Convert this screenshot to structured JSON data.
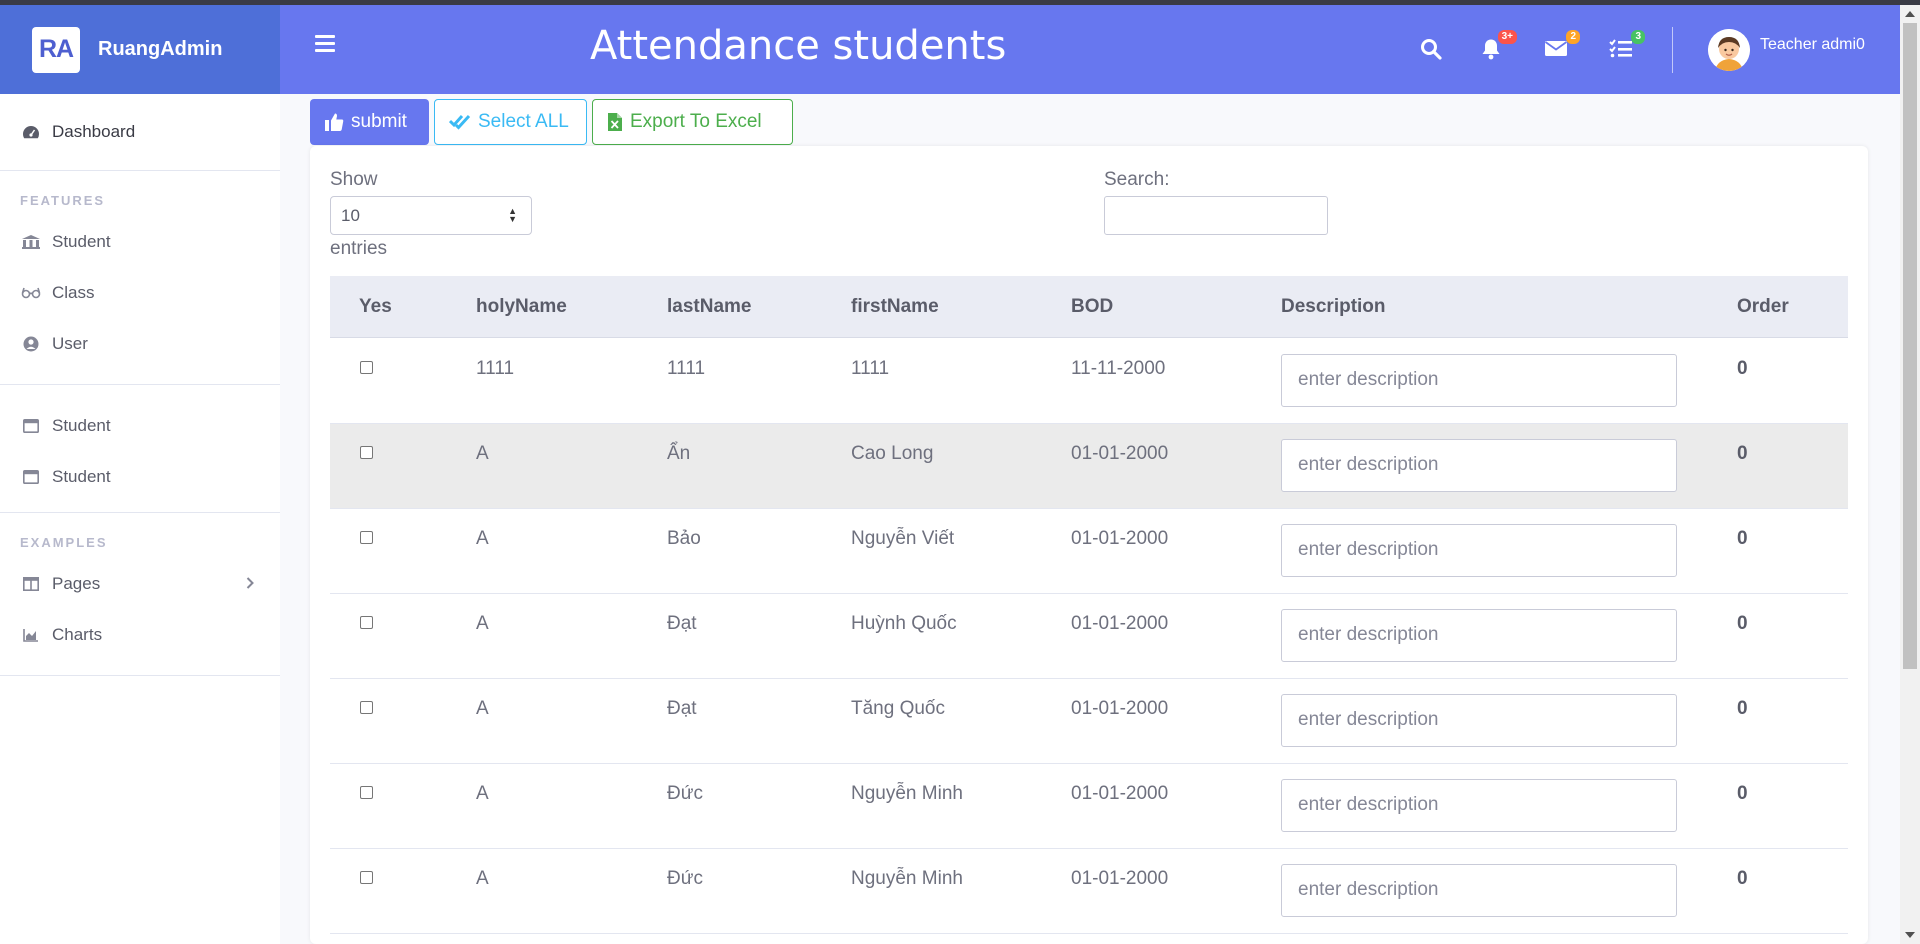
{
  "brand": {
    "logo_text": "RA",
    "name": "RuangAdmin"
  },
  "sidebar": {
    "dashboard": "Dashboard",
    "features_heading": "FEATURES",
    "features": [
      "Student",
      "Class",
      "User"
    ],
    "extra": [
      "Student",
      "Student"
    ],
    "examples_heading": "EXAMPLES",
    "examples": [
      "Pages",
      "Charts"
    ]
  },
  "topbar": {
    "title": "Attendance students",
    "notifications_badge": "3+",
    "messages_badge": "2",
    "tasks_badge": "3",
    "user_name": "Teacher admi0"
  },
  "actions": {
    "submit": "submit",
    "select_all": "Select ALL",
    "export": "Export To Excel"
  },
  "table_controls": {
    "show_label": "Show",
    "page_length": "10",
    "entries_label": "entries",
    "search_label": "Search:",
    "search_value": ""
  },
  "table": {
    "columns": [
      "Yes",
      "holyName",
      "lastName",
      "firstName",
      "BOD",
      "Description",
      "Order"
    ],
    "description_placeholder": "enter description",
    "rows": [
      {
        "holyName": "1111",
        "lastName": "1111",
        "firstName": "1111",
        "bod": "11-11-2000",
        "order": "0"
      },
      {
        "holyName": "A",
        "lastName": "Ẩn",
        "firstName": "Cao Long",
        "bod": "01-01-2000",
        "order": "0"
      },
      {
        "holyName": "A",
        "lastName": "Bảo",
        "firstName": "Nguyễn Viết",
        "bod": "01-01-2000",
        "order": "0"
      },
      {
        "holyName": "A",
        "lastName": "Đạt",
        "firstName": "Huỳnh Quốc",
        "bod": "01-01-2000",
        "order": "0"
      },
      {
        "holyName": "A",
        "lastName": "Đạt",
        "firstName": "Tăng Quốc",
        "bod": "01-01-2000",
        "order": "0"
      },
      {
        "holyName": "A",
        "lastName": "Đức",
        "firstName": "Nguyễn Minh",
        "bod": "01-01-2000",
        "order": "0"
      },
      {
        "holyName": "A",
        "lastName": "Đức",
        "firstName": "Nguyễn Minh",
        "bod": "01-01-2000",
        "order": "0"
      }
    ]
  },
  "colors": {
    "primary": "#6777ef",
    "sidebar_brand": "#4e6fd8",
    "info": "#3abaf4",
    "success": "#4cae4c",
    "badge_red": "#fc544b",
    "badge_yellow": "#ffa426",
    "badge_green": "#47c363"
  }
}
